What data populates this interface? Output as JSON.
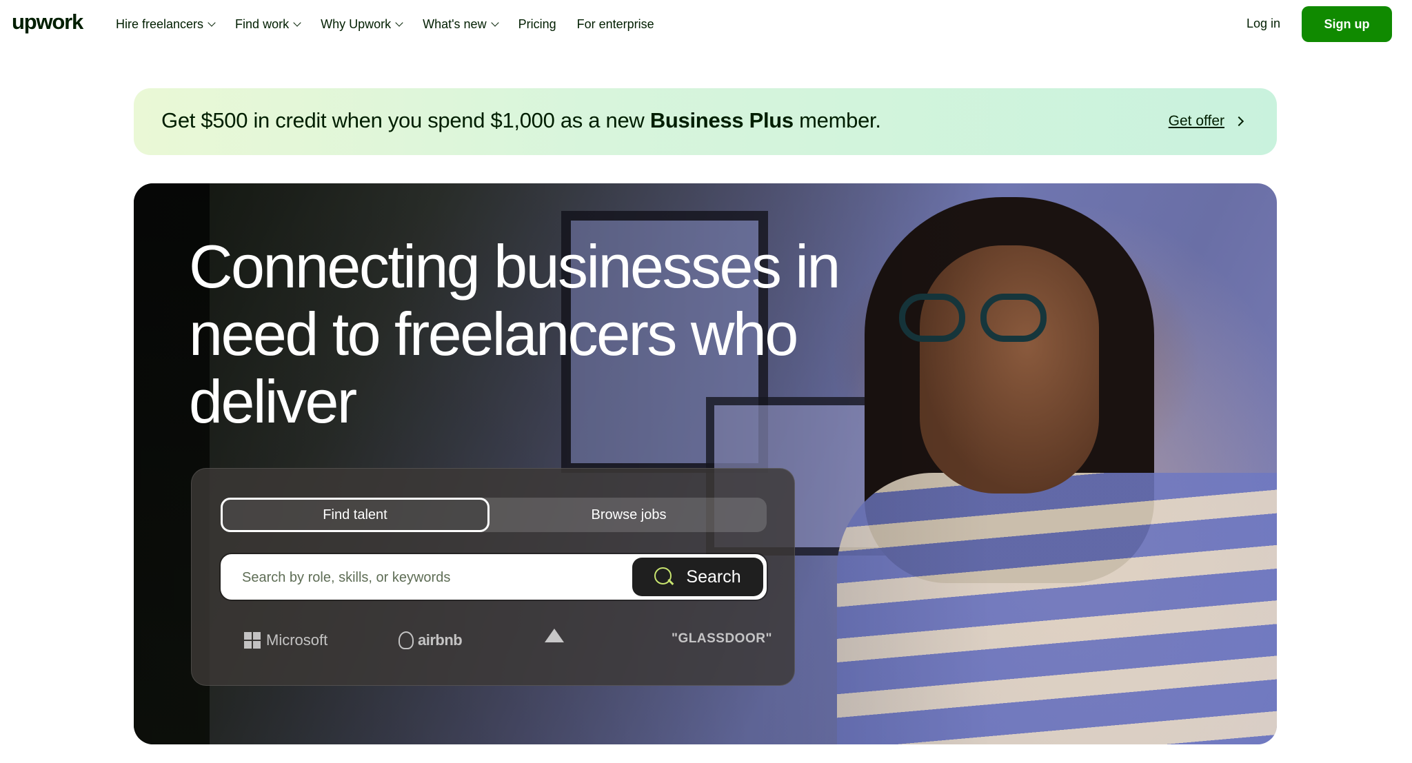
{
  "header": {
    "logo": "upwork",
    "nav": [
      {
        "label": "Hire freelancers",
        "dropdown": true
      },
      {
        "label": "Find work",
        "dropdown": true
      },
      {
        "label": "Why Upwork",
        "dropdown": true
      },
      {
        "label": "What's new",
        "dropdown": true
      },
      {
        "label": "Pricing",
        "dropdown": false
      },
      {
        "label": "For enterprise",
        "dropdown": false
      }
    ],
    "login_label": "Log in",
    "signup_label": "Sign up"
  },
  "promo": {
    "text_before": "Get $500 in credit when you spend $1,000 as a new ",
    "text_bold": "Business Plus",
    "text_after": " member.",
    "offer_label": "Get offer"
  },
  "hero": {
    "title": "Connecting businesses in need to freelancers who deliver",
    "tabs": [
      {
        "label": "Find talent",
        "active": true
      },
      {
        "label": "Browse jobs",
        "active": false
      }
    ],
    "search": {
      "placeholder": "Search by role, skills, or keywords",
      "value": "",
      "button_label": "Search"
    },
    "trusted_logos": [
      {
        "name": "Microsoft",
        "icon": "microsoft-logo"
      },
      {
        "name": "airbnb",
        "icon": "airbnb-logo"
      },
      {
        "name": "",
        "icon": "bissell-logo"
      },
      {
        "name": "\"GLASSDOOR\"",
        "icon": "glassdoor-logo"
      }
    ]
  },
  "colors": {
    "brand_green": "#108a00",
    "text_dark": "#001e00",
    "search_icon": "#c8e46f"
  }
}
